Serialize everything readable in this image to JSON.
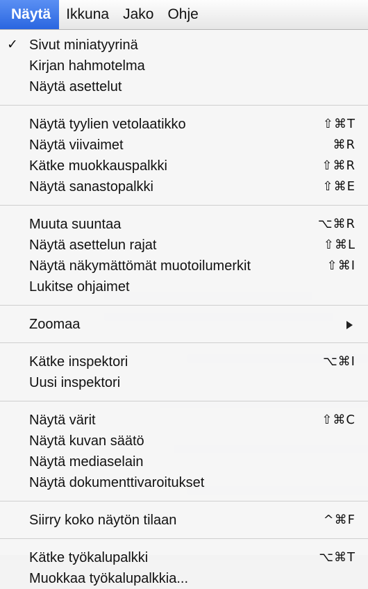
{
  "menubar": {
    "items": [
      {
        "label": "Näytä",
        "active": true
      },
      {
        "label": "Ikkuna"
      },
      {
        "label": "Jako"
      },
      {
        "label": "Ohje"
      }
    ]
  },
  "menu": {
    "groups": [
      [
        {
          "label": "Sivut miniatyyrinä",
          "checked": true,
          "shortcut": ""
        },
        {
          "label": "Kirjan hahmotelma",
          "shortcut": ""
        },
        {
          "label": "Näytä asettelut",
          "shortcut": ""
        }
      ],
      [
        {
          "label": "Näytä tyylien vetolaatikko",
          "shortcut": "⇧⌘T"
        },
        {
          "label": "Näytä viivaimet",
          "shortcut": "⌘R"
        },
        {
          "label": "Kätke muokkauspalkki",
          "shortcut": "⇧⌘R"
        },
        {
          "label": "Näytä sanastopalkki",
          "shortcut": "⇧⌘E"
        }
      ],
      [
        {
          "label": "Muuta suuntaa",
          "shortcut": "⌥⌘R"
        },
        {
          "label": "Näytä asettelun rajat",
          "shortcut": "⇧⌘L"
        },
        {
          "label": "Näytä näkymättömät muotoilumerkit",
          "shortcut": "⇧⌘I"
        },
        {
          "label": "Lukitse ohjaimet",
          "shortcut": ""
        }
      ],
      [
        {
          "label": "Zoomaa",
          "shortcut": "",
          "submenu": true
        }
      ],
      [
        {
          "label": "Kätke inspektori",
          "shortcut": "⌥⌘I"
        },
        {
          "label": "Uusi inspektori",
          "shortcut": ""
        }
      ],
      [
        {
          "label": "Näytä värit",
          "shortcut": "⇧⌘C"
        },
        {
          "label": "Näytä kuvan säätö",
          "shortcut": ""
        },
        {
          "label": "Näytä mediaselain",
          "shortcut": ""
        },
        {
          "label": "Näytä dokumenttivaroitukset",
          "shortcut": ""
        }
      ],
      [
        {
          "label": "Siirry koko näytön tilaan",
          "shortcut": "^⌘F"
        }
      ],
      [
        {
          "label": "Kätke työkalupalkki",
          "shortcut": "⌥⌘T"
        },
        {
          "label": "Muokkaa työkalupalkkia...",
          "shortcut": ""
        }
      ]
    ],
    "check_symbol": "✓"
  },
  "colors": {
    "highlight": "#2a66e0",
    "separator": "#cfcfcf"
  }
}
